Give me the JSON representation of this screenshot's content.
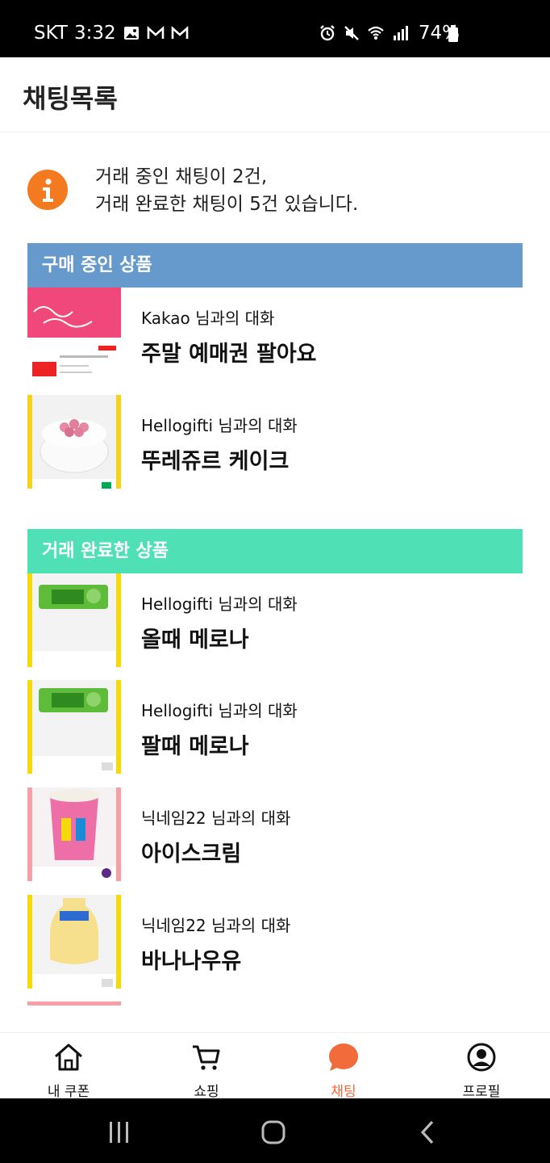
{
  "status_bar": {
    "carrier": "SKT",
    "time": "3:32",
    "battery": "74%"
  },
  "header": {
    "title": "채팅목록"
  },
  "info": {
    "line1": "거래 중인 채팅이 2건,",
    "line2": "거래 완료한 채팅이 5건 있습니다."
  },
  "sections": {
    "buying": {
      "label": "구매 중인 상품",
      "color": "#6699cc"
    },
    "done": {
      "label": "거래 완료한 상품",
      "color": "#4fe0b5"
    }
  },
  "buying_items": [
    {
      "partner": "Kakao 님과의 대화",
      "title": "주말 예매권 팔아요",
      "thumb": "cgv-ticket"
    },
    {
      "partner": "Hellogifti 님과의 대화",
      "title": "뚜레쥬르 케이크",
      "thumb": "cake"
    }
  ],
  "done_items": [
    {
      "partner": "Hellogifti 님과의 대화",
      "title": "올때 메로나",
      "thumb": "melona"
    },
    {
      "partner": "Hellogifti 님과의 대화",
      "title": "팔때 메로나",
      "thumb": "melona"
    },
    {
      "partner": "닉네임22 님과의 대화",
      "title": "아이스크림",
      "thumb": "icecream"
    },
    {
      "partner": "닉네임22 님과의 대화",
      "title": "바나나우유",
      "thumb": "banana-milk"
    }
  ],
  "bottom_nav": [
    {
      "label": "내 쿠폰",
      "icon": "home-icon"
    },
    {
      "label": "쇼핑",
      "icon": "cart-icon"
    },
    {
      "label": "채팅",
      "icon": "chat-icon",
      "active": true
    },
    {
      "label": "프로필",
      "icon": "profile-icon"
    }
  ],
  "colors": {
    "accent": "#f26b3a",
    "info_icon": "#f47a20",
    "melona_border": "#f5d90a"
  }
}
